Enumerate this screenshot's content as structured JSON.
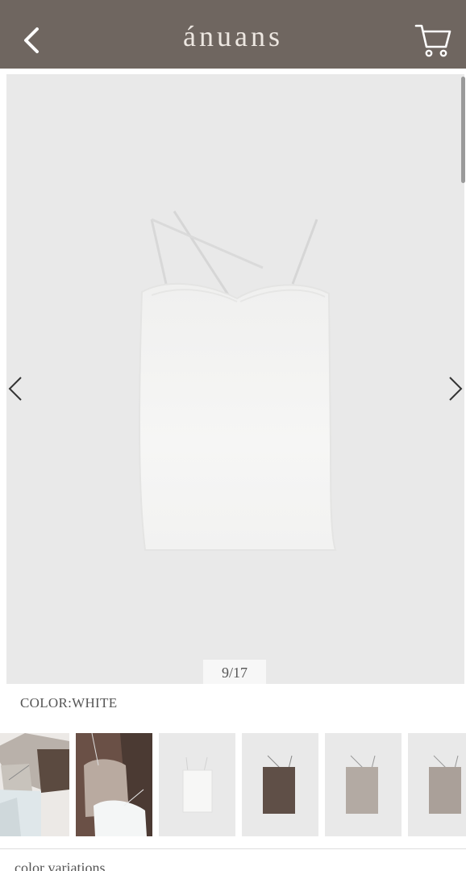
{
  "header": {
    "brand": "ánuans",
    "back_icon": "chevron-left-icon",
    "cart_icon": "cart-icon"
  },
  "gallery": {
    "counter": "9/17",
    "current_index": 9,
    "total": 17,
    "prev_icon": "chevron-left-icon",
    "next_icon": "chevron-right-icon"
  },
  "color": {
    "label": "COLOR:WHITE"
  },
  "thumbnails": [
    {
      "variant": "flatlay-mixed"
    },
    {
      "variant": "flatlay-duo"
    },
    {
      "variant": "white"
    },
    {
      "variant": "brown"
    },
    {
      "variant": "greige"
    },
    {
      "variant": "mocha"
    }
  ],
  "section": {
    "title": "color variations"
  },
  "colors": {
    "header_bg": "#6f6660",
    "brand_text": "#ede7e1",
    "gallery_bg": "#e9e9e9"
  }
}
